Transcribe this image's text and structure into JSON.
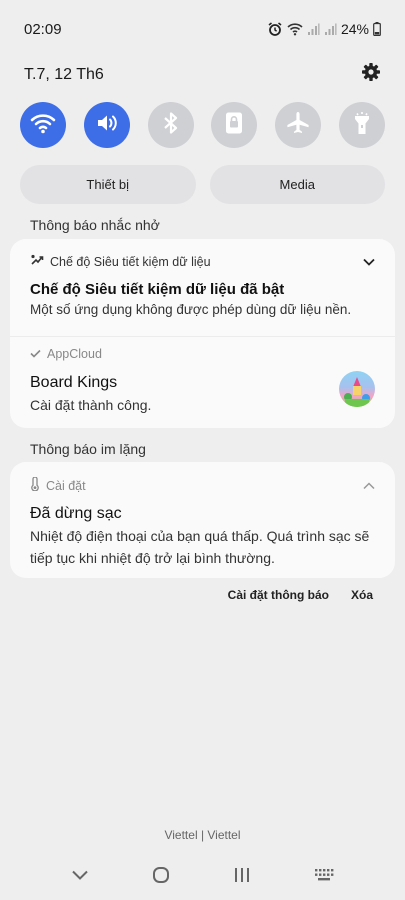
{
  "status_bar": {
    "time": "02:09",
    "battery": "24%"
  },
  "header": {
    "date": "T.7, 12 Th6"
  },
  "quick_settings": [
    {
      "icon": "wifi-icon",
      "on": true
    },
    {
      "icon": "sound-icon",
      "on": true
    },
    {
      "icon": "bluetooth-icon",
      "on": false
    },
    {
      "icon": "rotation-lock-icon",
      "on": false
    },
    {
      "icon": "airplane-icon",
      "on": false
    },
    {
      "icon": "flashlight-icon",
      "on": false
    }
  ],
  "device_buttons": {
    "devices": "Thiết bị",
    "media": "Media"
  },
  "sections": {
    "reminders": "Thông báo nhắc nhở",
    "silent": "Thông báo im lặng"
  },
  "notif_data_saver": {
    "app": "Chế độ Siêu tiết kiệm dữ liệu",
    "title": "Chế độ Siêu tiết kiệm dữ liệu đã bật",
    "text": "Một số ứng dụng không được phép dùng dữ liệu nền."
  },
  "notif_appcloud": {
    "app": "AppCloud",
    "title": "Board Kings",
    "text": "Cài đặt thành công."
  },
  "notif_settings": {
    "app": "Cài đặt",
    "title": "Đã dừng sạc",
    "text": "Nhiệt độ điện thoại của bạn quá thấp. Quá trình sạc sẽ tiếp tục khi nhiệt độ trở lại bình thường."
  },
  "actions": {
    "notification_settings": "Cài đặt thông báo",
    "clear": "Xóa"
  },
  "carrier": "Viettel | Viettel",
  "colors": {
    "accent": "#3d6ee8",
    "background": "#eeeeef"
  }
}
